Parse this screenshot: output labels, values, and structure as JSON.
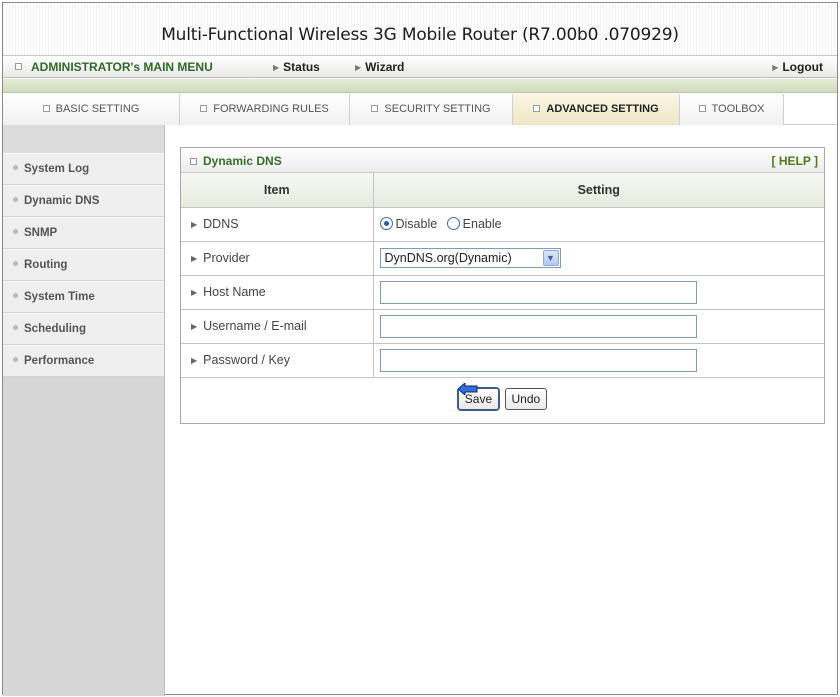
{
  "app": {
    "title": "Multi-Functional Wireless 3G Mobile Router (R7.00b0 .070929)"
  },
  "menu": {
    "admin_label": "ADMINISTRATOR's MAIN MENU",
    "status_label": "Status",
    "wizard_label": "Wizard",
    "logout_label": "Logout"
  },
  "tabs": [
    {
      "label": "BASIC SETTING"
    },
    {
      "label": "FORWARDING RULES"
    },
    {
      "label": "SECURITY SETTING"
    },
    {
      "label": "ADVANCED SETTING"
    },
    {
      "label": "TOOLBOX"
    }
  ],
  "active_tab": "ADVANCED SETTING",
  "sidebar": {
    "items": [
      {
        "label": "System Log"
      },
      {
        "label": "Dynamic DNS"
      },
      {
        "label": "SNMP"
      },
      {
        "label": "Routing"
      },
      {
        "label": "System Time"
      },
      {
        "label": "Scheduling"
      },
      {
        "label": "Performance"
      }
    ]
  },
  "panel": {
    "title": "Dynamic DNS",
    "help_label": "[ HELP ]",
    "col_item": "Item",
    "col_setting": "Setting",
    "rows": {
      "ddns": {
        "label": "DDNS",
        "opt_disable": "Disable",
        "opt_enable": "Enable",
        "selected": "Disable"
      },
      "provider": {
        "label": "Provider",
        "value": "DynDNS.org(Dynamic)"
      },
      "host": {
        "label": "Host Name",
        "value": ""
      },
      "username": {
        "label": "Username / E-mail",
        "value": ""
      },
      "password": {
        "label": "Password / Key",
        "value": ""
      }
    },
    "save_label": "Save",
    "undo_label": "Undo"
  },
  "colors": {
    "accent_green": "#3a6b2e",
    "sidebar_bg": "#d6d6d6",
    "active_tab_bg": "#efe6c6"
  }
}
